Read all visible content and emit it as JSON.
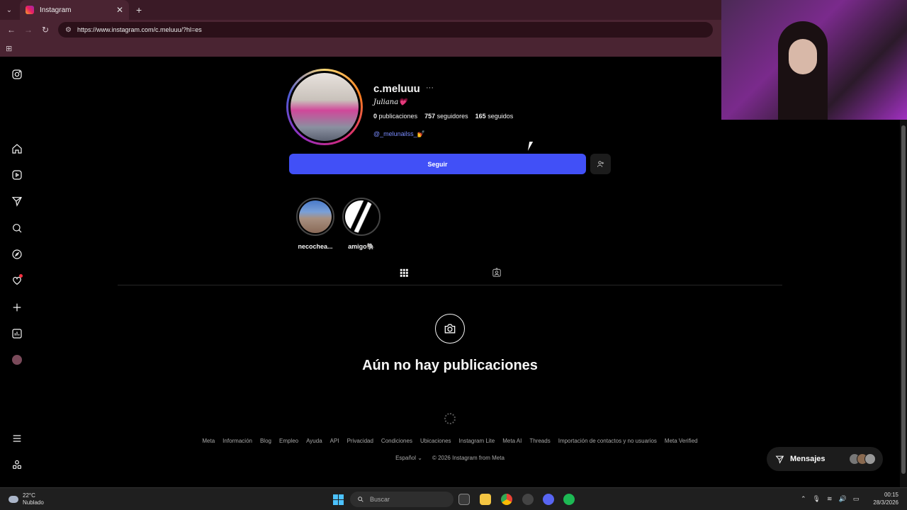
{
  "browser": {
    "tab_title": "Instagram",
    "url": "https://www.instagram.com/c.meluuu/?hl=es",
    "tab_close": "✕",
    "new_tab": "+"
  },
  "profile": {
    "username": "c.meluuu",
    "more": "···",
    "full_name": "Juliana💗",
    "posts_count": "0",
    "posts_label": "publicaciones",
    "followers_count": "757",
    "followers_label": "seguidores",
    "following_count": "165",
    "following_label": "seguidos",
    "linked_handle": "@_melunailss_💅",
    "follow_label": "Seguir"
  },
  "highlights": [
    {
      "label": "necochea..."
    },
    {
      "label": "amigo🐘"
    }
  ],
  "empty_state": {
    "title": "Aún no hay publicaciones"
  },
  "footer": {
    "links": [
      "Meta",
      "Información",
      "Blog",
      "Empleo",
      "Ayuda",
      "API",
      "Privacidad",
      "Condiciones",
      "Ubicaciones",
      "Instagram Lite",
      "Meta AI",
      "Threads",
      "Importación de contactos y no usuarios",
      "Meta Verified"
    ],
    "language": "Español",
    "copyright": "© 2026 Instagram from Meta"
  },
  "messages": {
    "label": "Mensajes"
  },
  "taskbar": {
    "temperature": "22°C",
    "weather": "Nublado",
    "search_placeholder": "Buscar",
    "time": "00:15",
    "date": "28/3/2026"
  },
  "colors": {
    "follow_button": "#4150f7",
    "link": "#7a8cff",
    "notification": "#ff3040"
  }
}
